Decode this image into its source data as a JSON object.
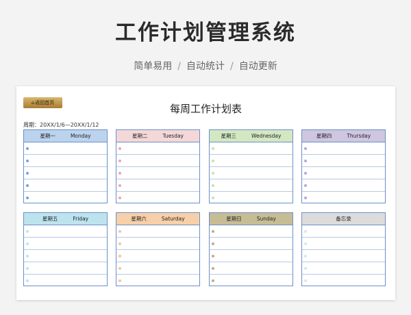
{
  "hero": {
    "title": "工作计划管理系统",
    "features": [
      "简单易用",
      "自动统计",
      "自动更新"
    ],
    "separator": "/"
  },
  "sheet": {
    "back_button": "返回首页",
    "title": "每周工作计划表",
    "period": "周期：20XX/1/6—20XX/1/12"
  },
  "cards": [
    {
      "cn": "星期一",
      "en": "Monday",
      "header_color": "#bcd3ee",
      "dot_color": "#7b9fd6"
    },
    {
      "cn": "星期二",
      "en": "Tuesday",
      "header_color": "#f4d8d8",
      "dot_color": "#e6a8b4"
    },
    {
      "cn": "星期三",
      "en": "Wednesday",
      "header_color": "#d3e7c2",
      "dot_color": "#cfe0a8"
    },
    {
      "cn": "星期四",
      "en": "Thursday",
      "header_color": "#cfc6e2",
      "dot_color": "#b6a6d8"
    },
    {
      "cn": "星期五",
      "en": "Friday",
      "header_color": "#bde3ee",
      "dot_color": "#bde3ee"
    },
    {
      "cn": "星期六",
      "en": "Saturday",
      "header_color": "#f7cfa8",
      "dot_color": "#f1c3a8"
    },
    {
      "cn": "星期日",
      "en": "Sunday",
      "header_color": "#c7bd95",
      "dot_color": "#c0ad8a"
    },
    {
      "cn": "备忘录",
      "en": "",
      "header_color": "#dcdcdc",
      "dot_color": "#d6e6ee"
    }
  ]
}
